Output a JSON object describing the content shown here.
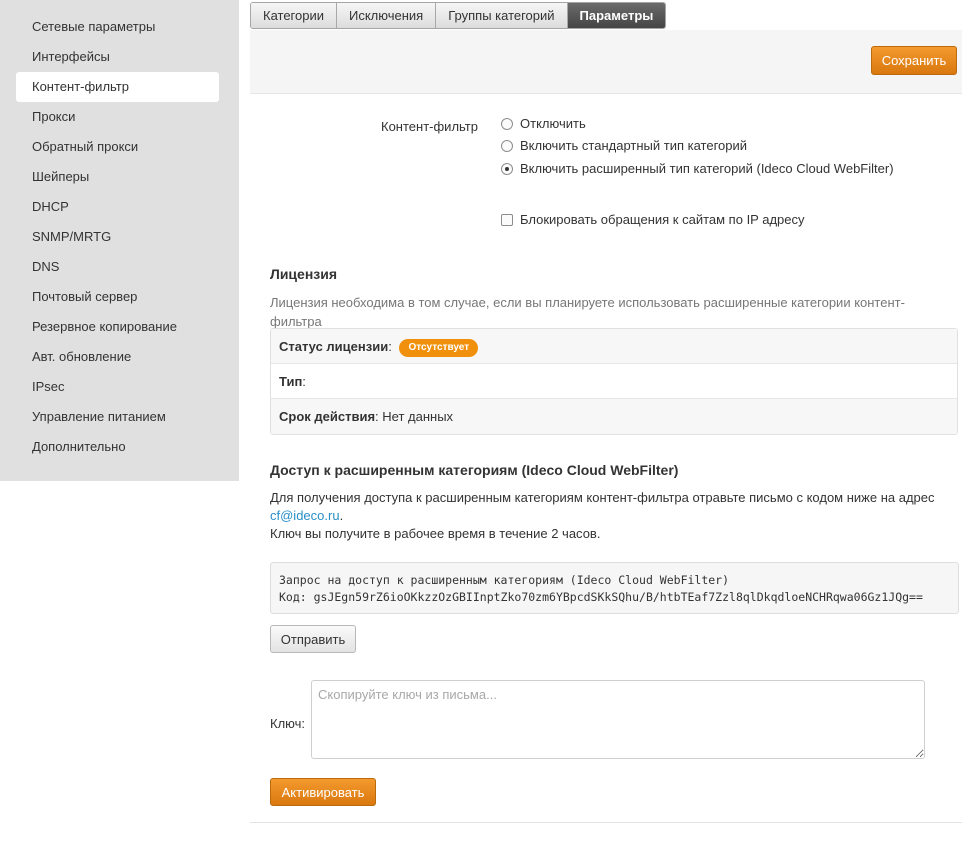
{
  "sidebar": {
    "items": [
      {
        "label": "Сетевые параметры"
      },
      {
        "label": "Интерфейсы"
      },
      {
        "label": "Контент-фильтр"
      },
      {
        "label": "Прокси"
      },
      {
        "label": "Обратный прокси"
      },
      {
        "label": "Шейперы"
      },
      {
        "label": "DHCP"
      },
      {
        "label": "SNMP/MRTG"
      },
      {
        "label": "DNS"
      },
      {
        "label": "Почтовый сервер"
      },
      {
        "label": "Резервное копирование"
      },
      {
        "label": "Авт. обновление"
      },
      {
        "label": "IPsec"
      },
      {
        "label": "Управление питанием"
      },
      {
        "label": "Дополнительно"
      }
    ],
    "active_index": 2
  },
  "tabs": [
    {
      "label": "Категории"
    },
    {
      "label": "Исключения"
    },
    {
      "label": "Группы категорий"
    },
    {
      "label": "Параметры"
    }
  ],
  "toolbar": {
    "save_label": "Сохранить"
  },
  "content_filter": {
    "label": "Контент-фильтр",
    "options": [
      {
        "label": "Отключить",
        "checked": false
      },
      {
        "label": "Включить стандартный тип категорий",
        "checked": false
      },
      {
        "label": "Включить расширенный тип категорий (Ideco Cloud WebFilter)",
        "checked": true
      }
    ],
    "block_ip_label": "Блокировать обращения к сайтам по IP адресу",
    "block_ip_checked": false
  },
  "license": {
    "title": "Лицензия",
    "description": "Лицензия необходима в том случае, если вы планируете использовать расширенные категории контент-фильтра",
    "status_label": "Статус лицензии",
    "status_value": "Отсутствует",
    "type_label": "Тип",
    "type_value": "",
    "expiry_label": "Срок действия",
    "expiry_value": "Нет данных"
  },
  "access": {
    "title": "Доступ к расширенным категориям (Ideco Cloud WebFilter)",
    "desc_line1": "Для получения доступа к расширенным категориям контент-фильтра отравьте письмо с кодом ниже на адрес",
    "email": "cf@ideco.ru",
    "desc_after_email": ".",
    "desc_line2": "Ключ вы получите в рабочее время в течение 2 часов.",
    "request_line1": "Запрос на доступ к расширенным категориям (Ideco Cloud WebFilter)",
    "request_line2": "Код: gsJEgn59rZ6ioOKkzzOzGBIInptZko70zm6YBpcdSKkSQhu/B/htbTEaf7Zzl8qlDkqdloeNCHRqwa06Gz1JQg==",
    "send_label": "Отправить",
    "key_label": "Ключ:",
    "key_placeholder": "Скопируйте ключ из письма...",
    "activate_label": "Активировать"
  },
  "colors": {
    "accent": "#e8870f",
    "badge": "#f0900c",
    "link": "#2a8fc8",
    "sidebar_bg": "#e0e0e0",
    "tab_active": "#555555"
  }
}
